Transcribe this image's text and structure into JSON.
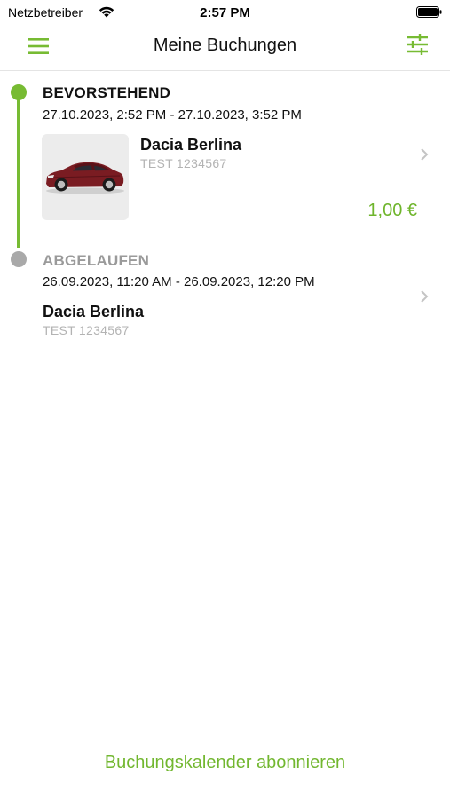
{
  "status_bar": {
    "carrier": "Netzbetreiber",
    "time": "2:57 PM",
    "wifi_icon": "wifi-icon",
    "battery_icon": "battery-icon"
  },
  "nav": {
    "title": "Meine Buchungen",
    "menu_icon": "hamburger-menu-icon",
    "filter_icon": "sliders-filter-icon"
  },
  "colors": {
    "accent": "#77bb33",
    "inactive": "#a9a9a9",
    "muted_text": "#b3b3b3"
  },
  "bookings": {
    "upcoming": {
      "status": "BEVORSTEHEND",
      "time_range": "27.10.2023, 2:52 PM - 27.10.2023, 3:52 PM",
      "vehicle": "Dacia Berlina",
      "plate": "TEST 1234567",
      "price": "1,00 €",
      "image_icon": "car-image"
    },
    "expired": {
      "status": "ABGELAUFEN",
      "time_range": "26.09.2023, 11:20 AM - 26.09.2023, 12:20 PM",
      "vehicle": "Dacia Berlina",
      "plate": "TEST 1234567"
    }
  },
  "footer": {
    "subscribe_label": "Buchungskalender abonnieren"
  }
}
